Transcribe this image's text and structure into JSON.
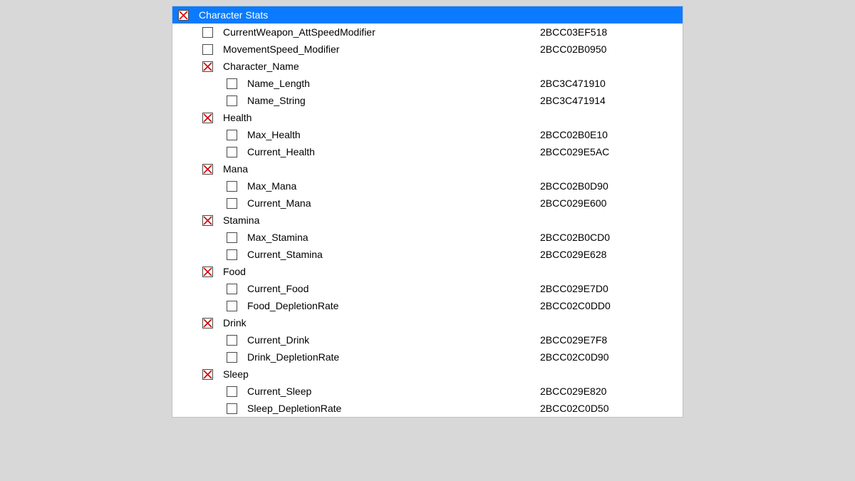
{
  "root": {
    "label": "Character Stats",
    "checked": true,
    "items": [
      {
        "label": "CurrentWeapon_AttSpeedModifier",
        "address": "2BCC03EF518",
        "checked": false
      },
      {
        "label": "MovementSpeed_Modifier",
        "address": "2BCC02B0950",
        "checked": false
      },
      {
        "label": "Character_Name",
        "checked": true,
        "children": [
          {
            "label": "Name_Length",
            "address": "2BC3C471910",
            "checked": false
          },
          {
            "label": "Name_String",
            "address": "2BC3C471914",
            "checked": false
          }
        ]
      },
      {
        "label": "Health",
        "checked": true,
        "children": [
          {
            "label": "Max_Health",
            "address": "2BCC02B0E10",
            "checked": false
          },
          {
            "label": "Current_Health",
            "address": "2BCC029E5AC",
            "checked": false
          }
        ]
      },
      {
        "label": "Mana",
        "checked": true,
        "children": [
          {
            "label": "Max_Mana",
            "address": "2BCC02B0D90",
            "checked": false
          },
          {
            "label": "Current_Mana",
            "address": "2BCC029E600",
            "checked": false
          }
        ]
      },
      {
        "label": "Stamina",
        "checked": true,
        "children": [
          {
            "label": "Max_Stamina",
            "address": "2BCC02B0CD0",
            "checked": false
          },
          {
            "label": "Current_Stamina",
            "address": "2BCC029E628",
            "checked": false
          }
        ]
      },
      {
        "label": "Food",
        "checked": true,
        "children": [
          {
            "label": "Current_Food",
            "address": "2BCC029E7D0",
            "checked": false
          },
          {
            "label": "Food_DepletionRate",
            "address": "2BCC02C0DD0",
            "checked": false
          }
        ]
      },
      {
        "label": "Drink",
        "checked": true,
        "children": [
          {
            "label": "Current_Drink",
            "address": "2BCC029E7F8",
            "checked": false
          },
          {
            "label": "Drink_DepletionRate",
            "address": "2BCC02C0D90",
            "checked": false
          }
        ]
      },
      {
        "label": "Sleep",
        "checked": true,
        "children": [
          {
            "label": "Current_Sleep",
            "address": "2BCC029E820",
            "checked": false
          },
          {
            "label": "Sleep_DepletionRate",
            "address": "2BCC02C0D50",
            "checked": false
          }
        ]
      }
    ]
  }
}
